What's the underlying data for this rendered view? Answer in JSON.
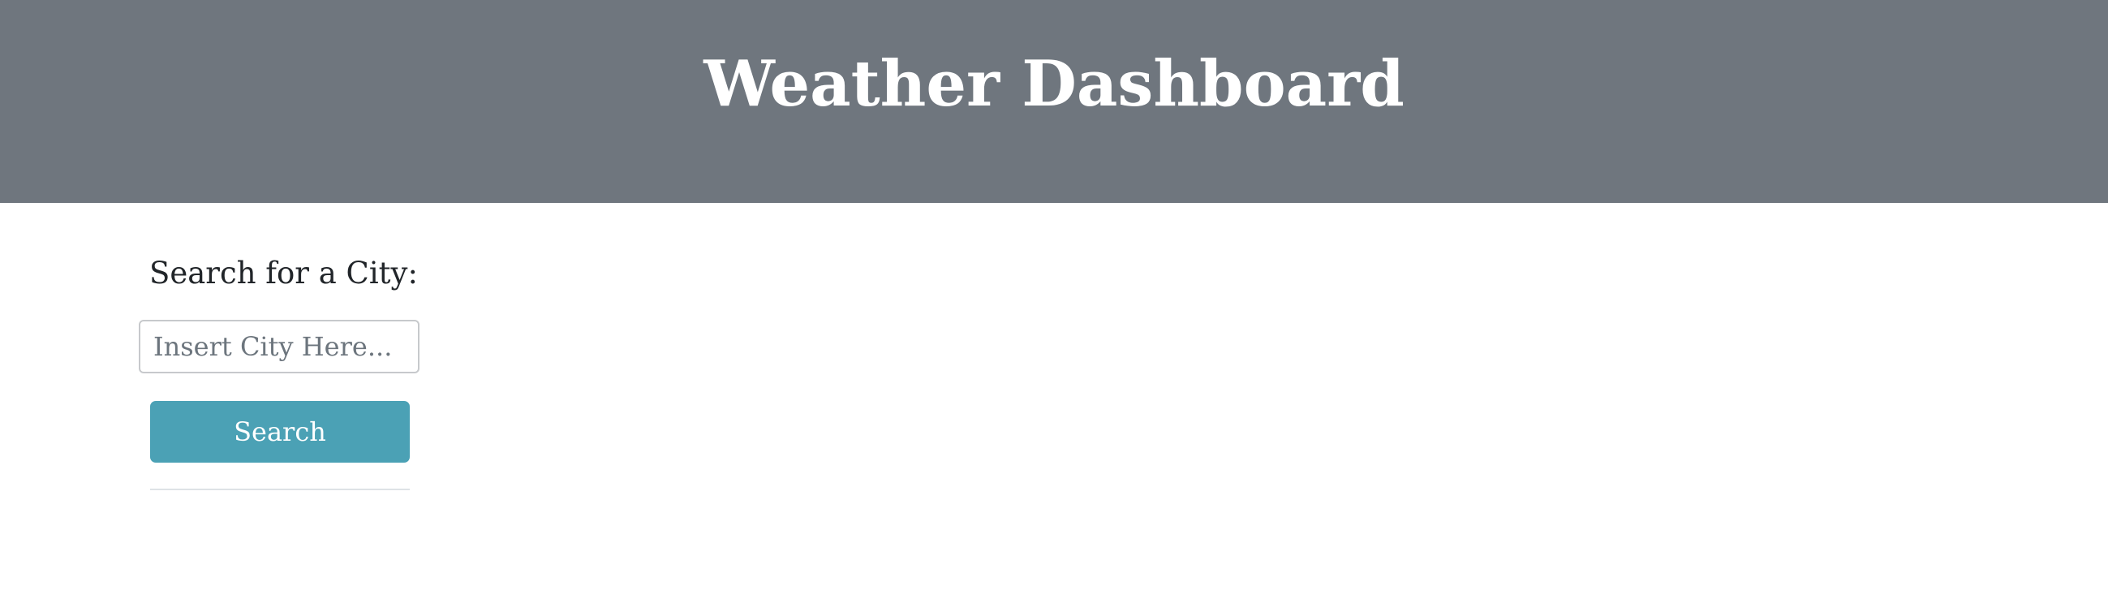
{
  "header": {
    "title": "Weather Dashboard"
  },
  "search": {
    "heading": "Search for a City:",
    "placeholder": "Insert City Here...",
    "value": "",
    "button_label": "Search"
  },
  "colors": {
    "header_background": "#6f767e",
    "button_background": "#4ba1b5"
  }
}
